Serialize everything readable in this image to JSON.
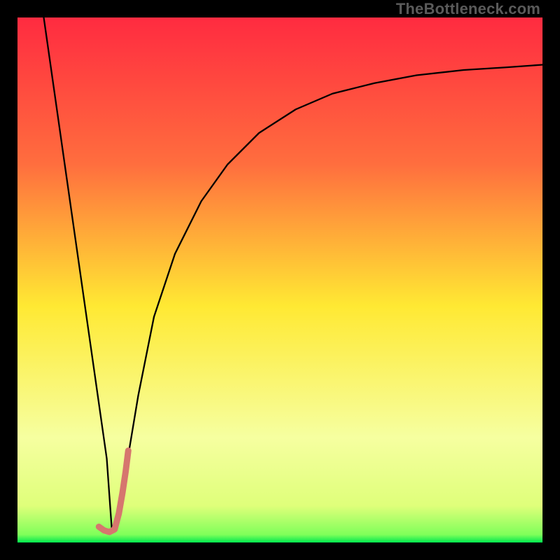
{
  "watermark": {
    "text": "TheBottleneck.com"
  },
  "colors": {
    "black": "#000000",
    "green": "#00e84e",
    "yellow": "#ffe933",
    "orange": "#ffa940",
    "red": "#ff2b40",
    "accent_pink": "#d6766e",
    "curve": "#000000"
  },
  "chart_data": {
    "type": "line",
    "title": "",
    "xlabel": "",
    "ylabel": "",
    "xlim": [
      0,
      100
    ],
    "ylim": [
      0,
      100
    ],
    "legend": false,
    "grid": false,
    "gradient_stops": [
      {
        "pos": 0.0,
        "color": "#ff2b40"
      },
      {
        "pos": 0.28,
        "color": "#ff6e3e"
      },
      {
        "pos": 0.55,
        "color": "#ffe933"
      },
      {
        "pos": 0.8,
        "color": "#f6ffa0"
      },
      {
        "pos": 0.93,
        "color": "#dfff7a"
      },
      {
        "pos": 0.985,
        "color": "#7fff5a"
      },
      {
        "pos": 1.0,
        "color": "#00e84e"
      }
    ],
    "series": [
      {
        "name": "bottleneck-curve",
        "color": "#000000",
        "width": 2.3,
        "x": [
          5,
          8,
          11,
          14,
          17,
          18,
          20,
          23,
          26,
          30,
          35,
          40,
          46,
          53,
          60,
          68,
          76,
          85,
          93,
          100
        ],
        "y": [
          100,
          79,
          58,
          37,
          16,
          2,
          10,
          28,
          43,
          55,
          65,
          72,
          78,
          82.5,
          85.5,
          87.5,
          89,
          90,
          90.5,
          91
        ]
      },
      {
        "name": "accent-tick",
        "color": "#d6766e",
        "width": 9,
        "x": [
          15.5,
          16.5,
          17.5,
          18.5,
          19.3,
          20.0,
          20.6,
          21.1
        ],
        "y": [
          3.0,
          2.3,
          2.0,
          2.5,
          5.5,
          9.5,
          13.5,
          17.5
        ]
      }
    ]
  }
}
